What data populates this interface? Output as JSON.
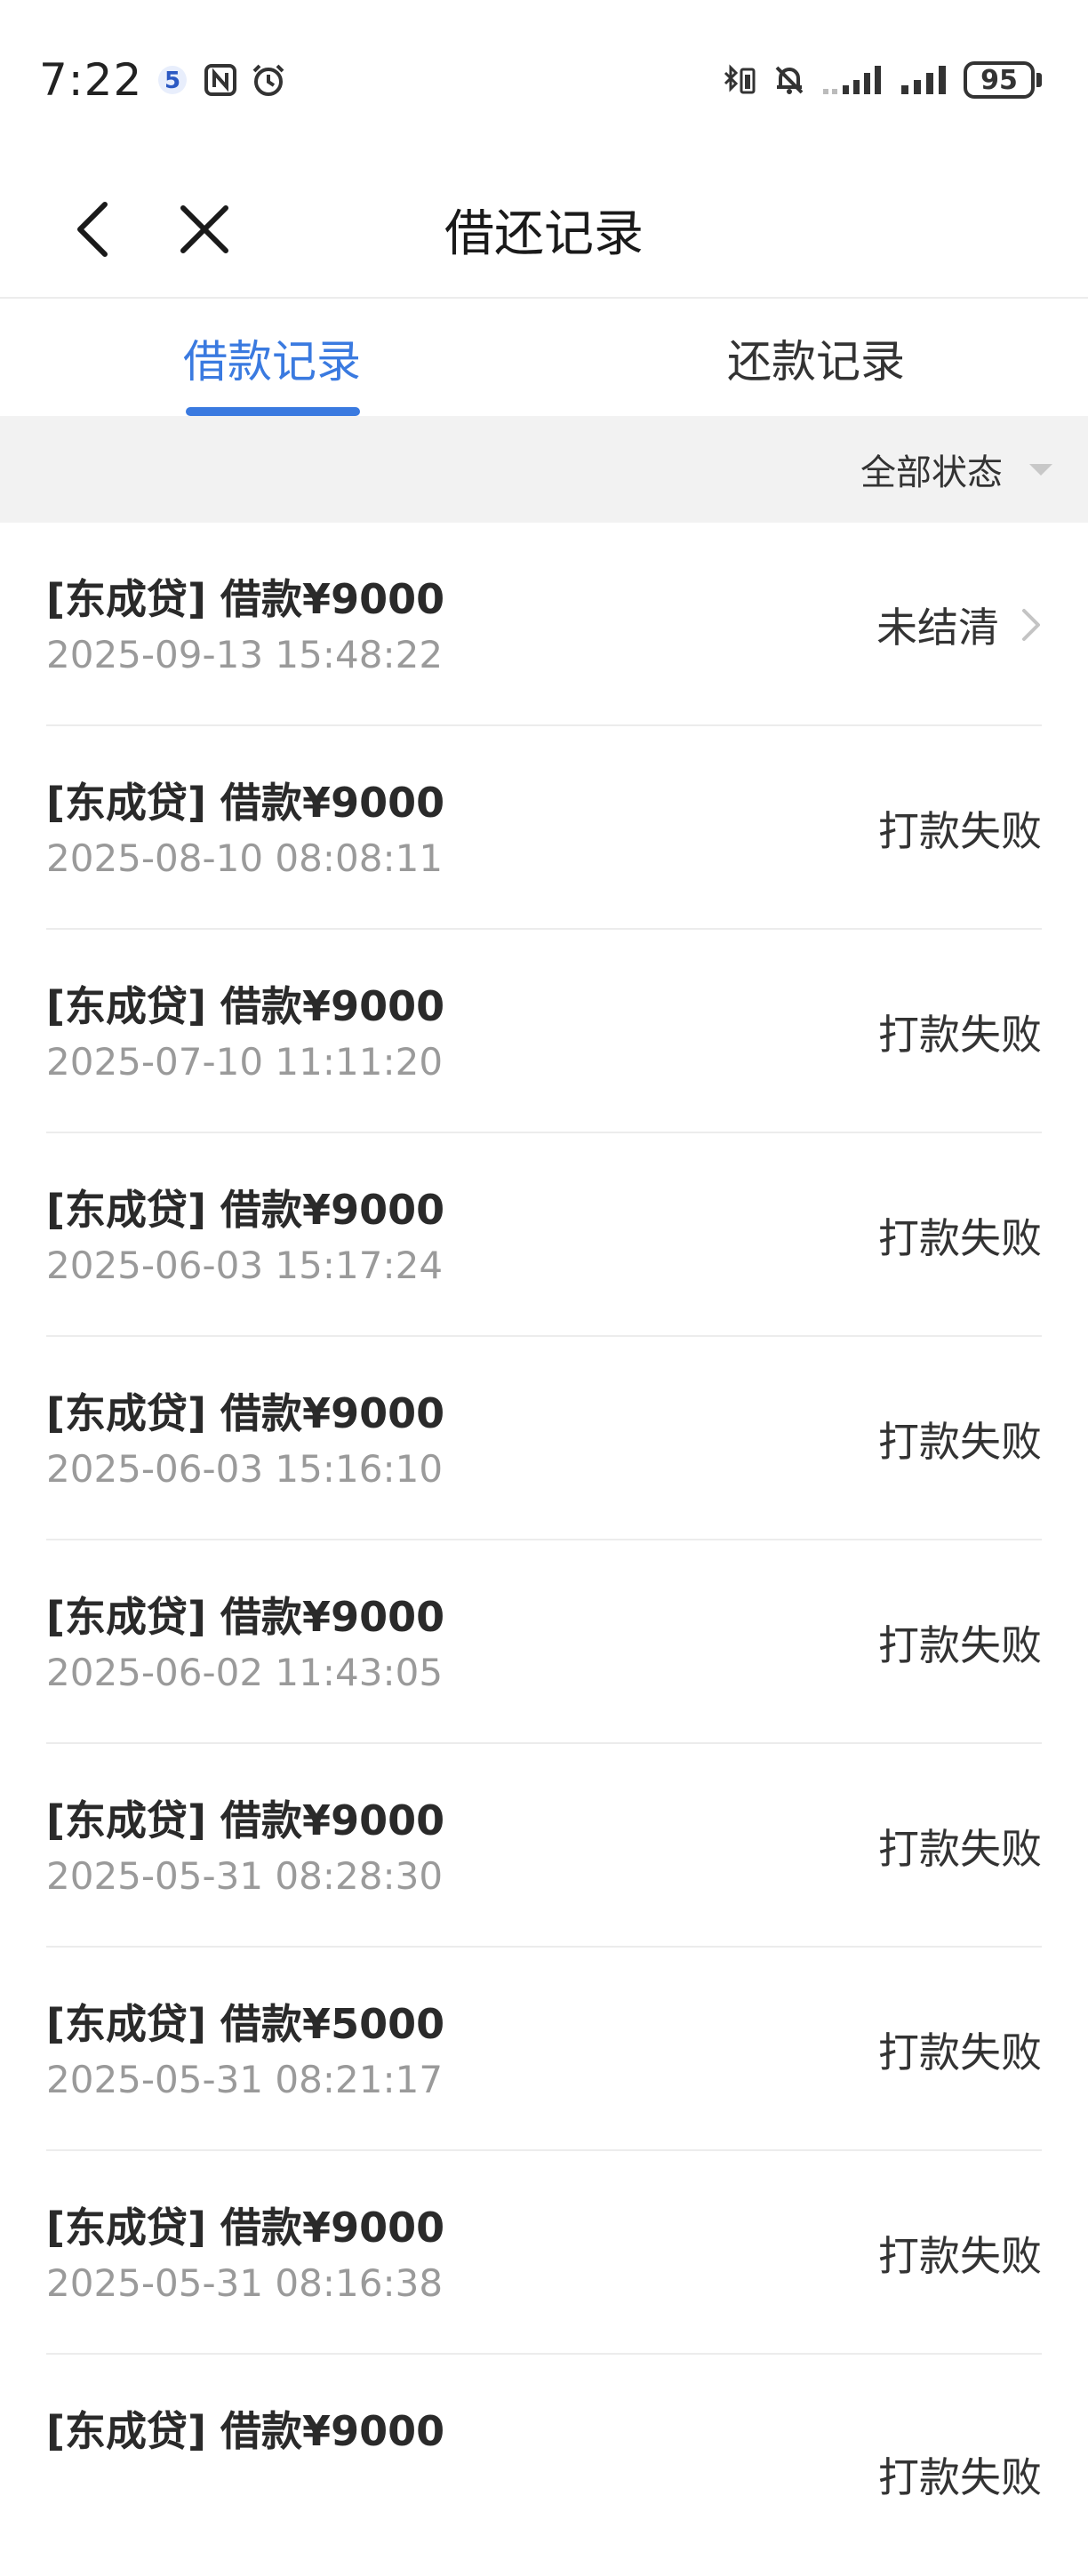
{
  "status_bar": {
    "time": "7:22",
    "battery": "95",
    "icons": [
      "app-5-icon",
      "nfc-icon",
      "alarm-icon",
      "bluetooth-battery-icon",
      "mute-icon",
      "signal-icon",
      "signal-icon"
    ]
  },
  "nav": {
    "title": "借还记录",
    "back_icon": "chevron-left-icon",
    "close_icon": "close-icon"
  },
  "tabs": [
    {
      "label": "借款记录",
      "active": true
    },
    {
      "label": "还款记录",
      "active": false
    }
  ],
  "filter": {
    "label": "全部状态"
  },
  "records": [
    {
      "title": "[东成贷] 借款¥9000",
      "time": "2025-09-13 15:48:22",
      "status": "未结清"
    },
    {
      "title": "[东成贷] 借款¥9000",
      "time": "2025-08-10 08:08:11",
      "status": "打款失败"
    },
    {
      "title": "[东成贷] 借款¥9000",
      "time": "2025-07-10 11:11:20",
      "status": "打款失败"
    },
    {
      "title": "[东成贷] 借款¥9000",
      "time": "2025-06-03 15:17:24",
      "status": "打款失败"
    },
    {
      "title": "[东成贷] 借款¥9000",
      "time": "2025-06-03 15:16:10",
      "status": "打款失败"
    },
    {
      "title": "[东成贷] 借款¥9000",
      "time": "2025-06-02 11:43:05",
      "status": "打款失败"
    },
    {
      "title": "[东成贷] 借款¥9000",
      "time": "2025-05-31 08:28:30",
      "status": "打款失败"
    },
    {
      "title": "[东成贷] 借款¥5000",
      "time": "2025-05-31 08:21:17",
      "status": "打款失败"
    },
    {
      "title": "[东成贷] 借款¥9000",
      "time": "2025-05-31 08:16:38",
      "status": "打款失败"
    },
    {
      "title": "[东成贷] 借款¥9000",
      "time": "",
      "status": "打款失败"
    }
  ],
  "colors": {
    "accent": "#3a7ae0",
    "filter_bg": "#f2f2f2",
    "secondary_text": "#9a9a9a"
  }
}
